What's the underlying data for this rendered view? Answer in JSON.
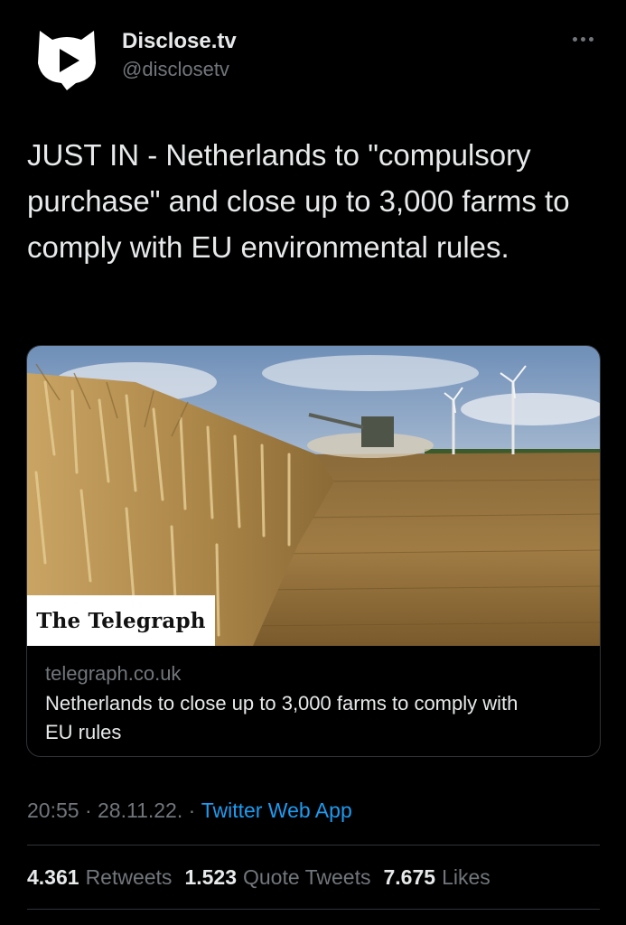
{
  "author": {
    "display_name": "Disclose.tv",
    "handle": "@disclosetv",
    "avatar_icon": "disclose-play-logo-icon"
  },
  "more_icon": "ellipsis-icon",
  "tweet": {
    "text": "JUST IN - Netherlands to \"compulsory purchase\" and close up to 3,000 farms to comply with EU environmental rules."
  },
  "card": {
    "image_alt": "wheat field with combine harvester and wind turbines",
    "source_logo": "The Telegraph",
    "domain": "telegraph.co.uk",
    "title": "Netherlands to close up to 3,000 farms to comply with EU rules"
  },
  "meta": {
    "time": "20:55",
    "separator": " · ",
    "date": "28.11.22.",
    "app": "Twitter Web App"
  },
  "stats": {
    "retweets": "4.361",
    "retweets_label": "Retweets",
    "quotes": "1.523",
    "quotes_label": "Quote Tweets",
    "likes": "7.675",
    "likes_label": "Likes"
  },
  "colors": {
    "background": "#000000",
    "text": "#e7e9ea",
    "muted": "#71767b",
    "link": "#1d9bf0",
    "border": "#2f3336"
  }
}
